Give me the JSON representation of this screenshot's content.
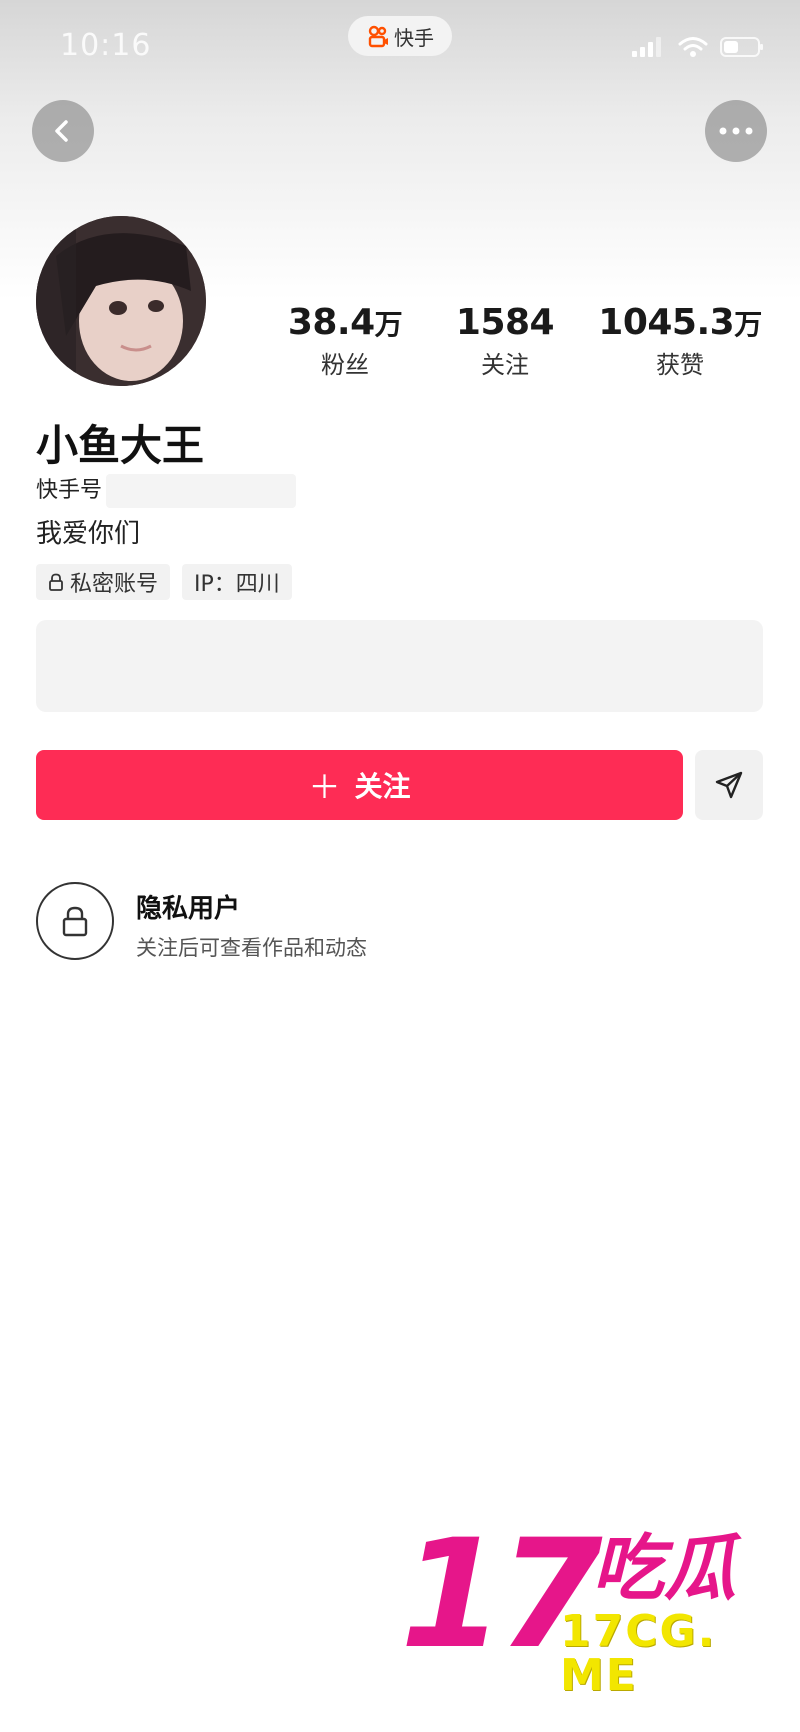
{
  "status_bar": {
    "time": "10:16",
    "app_name": "快手"
  },
  "profile": {
    "name": "小鱼大王",
    "id_label": "快手号",
    "bio": "我爱你们",
    "tags": {
      "private": "私密账号",
      "ip": "IP：四川"
    },
    "stats": {
      "fans": {
        "value": "38.4",
        "unit": "万",
        "label": "粉丝"
      },
      "following": {
        "value": "1584",
        "unit": "",
        "label": "关注"
      },
      "likes": {
        "value": "1045.3",
        "unit": "万",
        "label": "获赞"
      }
    }
  },
  "actions": {
    "follow_plus": "＋",
    "follow_label": "关注"
  },
  "private_notice": {
    "title": "隐私用户",
    "subtitle": "关注后可查看作品和动态"
  },
  "watermark": {
    "number": "17",
    "chinese": "吃瓜",
    "url": "17CG. ME"
  },
  "colors": {
    "accent": "#fe2c55",
    "watermark_pink": "#e6168a",
    "watermark_yellow": "#f2e600"
  }
}
